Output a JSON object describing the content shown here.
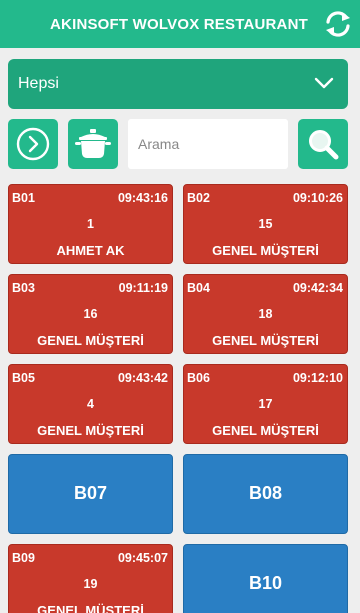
{
  "header": {
    "title": "AKINSOFT WOLVOX RESTAURANT",
    "refresh_icon": "refresh-icon"
  },
  "filter": {
    "selected": "Hepsi"
  },
  "search": {
    "placeholder": "Arama"
  },
  "tables": [
    {
      "code": "B01",
      "time": "09:43:16",
      "guests": "1",
      "customer": "AHMET AK",
      "status": "occupied"
    },
    {
      "code": "B02",
      "time": "09:10:26",
      "guests": "15",
      "customer": "GENEL MÜŞTERİ",
      "status": "occupied"
    },
    {
      "code": "B03",
      "time": "09:11:19",
      "guests": "16",
      "customer": "GENEL MÜŞTERİ",
      "status": "occupied"
    },
    {
      "code": "B04",
      "time": "09:42:34",
      "guests": "18",
      "customer": "GENEL MÜŞTERİ",
      "status": "occupied"
    },
    {
      "code": "B05",
      "time": "09:43:42",
      "guests": "4",
      "customer": "GENEL MÜŞTERİ",
      "status": "occupied"
    },
    {
      "code": "B06",
      "time": "09:12:10",
      "guests": "17",
      "customer": "GENEL MÜŞTERİ",
      "status": "occupied"
    },
    {
      "code": "B07",
      "status": "empty"
    },
    {
      "code": "B08",
      "status": "empty"
    },
    {
      "code": "B09",
      "time": "09:45:07",
      "guests": "19",
      "customer": "GENEL MÜŞTERİ",
      "status": "occupied"
    },
    {
      "code": "B10",
      "status": "empty"
    }
  ],
  "colors": {
    "accent": "#23b98c",
    "occupied": "#c8392b",
    "empty": "#2a7fc4"
  }
}
